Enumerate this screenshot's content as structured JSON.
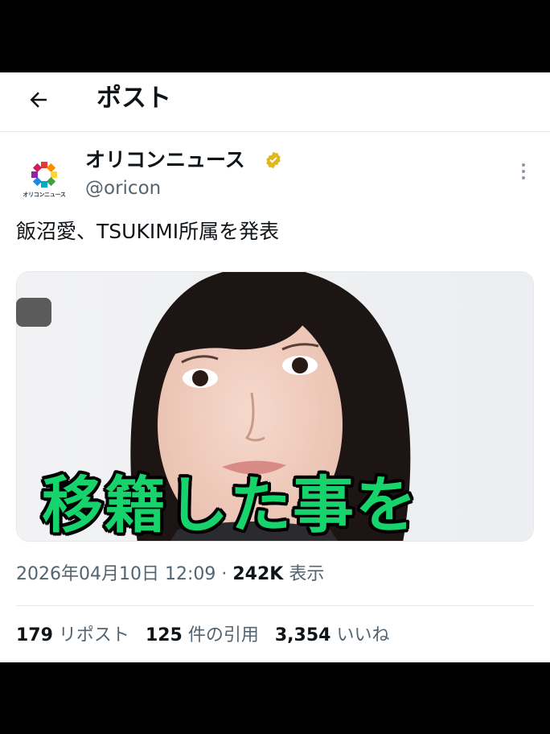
{
  "header": {
    "title": "ポスト"
  },
  "author": {
    "name": "オリコンニュース",
    "handle": "@oricon",
    "logo_text": "オリコンニュース"
  },
  "tweet": {
    "text": "飯沼愛、TSUKIMI所属を発表"
  },
  "caption": {
    "text": "移籍した事を"
  },
  "meta": {
    "date": "2026年04月10日 12:09",
    "separator": " · ",
    "views_count": "242K",
    "views_label": " 表示"
  },
  "stats": [
    {
      "count": "179",
      "label": " リポスト"
    },
    {
      "count": "125",
      "label": " 件の引用"
    },
    {
      "count": "3,354",
      "label": " いいね"
    }
  ],
  "colors": {
    "caption_fill": "#16d36c",
    "verified_gold": "#e2b719",
    "text_primary": "#0f1419",
    "text_secondary": "#536471"
  }
}
